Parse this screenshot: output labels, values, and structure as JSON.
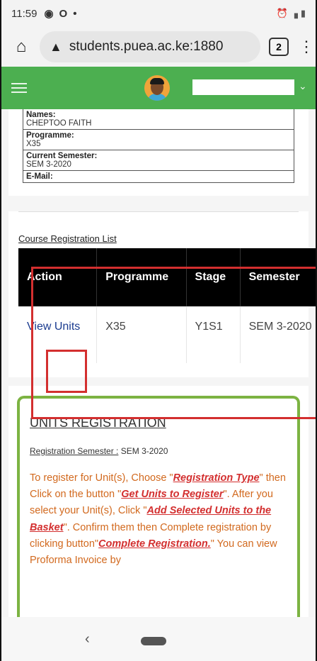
{
  "status": {
    "time": "11:59",
    "icons": [
      "facebook-icon",
      "opera-icon",
      "dot-icon"
    ],
    "right_icons": [
      "alarm-icon",
      "signal-icon",
      "battery-icon"
    ]
  },
  "browser": {
    "url": "students.puea.ac.ke:1880",
    "tab_count": "2"
  },
  "header": {
    "user_name": ""
  },
  "student": {
    "rows": [
      {
        "label": "Names:",
        "value": "CHEPTOO FAITH"
      },
      {
        "label": "Programme:",
        "value": "X35"
      },
      {
        "label": "Current Semester:",
        "value": "SEM 3-2020"
      },
      {
        "label": "E-Mail:",
        "value": ""
      }
    ]
  },
  "course_registration": {
    "title": "Course Registration List",
    "columns": [
      "Action",
      "Programme",
      "Stage",
      "Semester"
    ],
    "rows": [
      {
        "action": "View Units",
        "programme": "X35",
        "stage": "Y1S1",
        "semester": "SEM 3-2020"
      }
    ]
  },
  "units_registration": {
    "title": "UNITS REGISTRATION",
    "semester_label": "Registration Semester :",
    "semester_value": "SEM 3-2020",
    "instructions": {
      "t1": "To register for Unit(s), Choose \"",
      "h1": "Registration Type",
      "t2": "\" then Click on the button \"",
      "h2": "Get Units to Register",
      "t3": "\". After you select your Unit(s), Click \"",
      "h3": "Add Selected Units to the Basket",
      "t4": "\". Confirm them then Complete registration by clicking button\"",
      "h4": "Complete Registration.",
      "t5": "\" You can view Proforma Invoice by"
    }
  },
  "colors": {
    "header_green": "#4caf50",
    "highlight_red": "#d32f2f",
    "units_border": "#7cb342",
    "instruction_orange": "#d2691e"
  }
}
